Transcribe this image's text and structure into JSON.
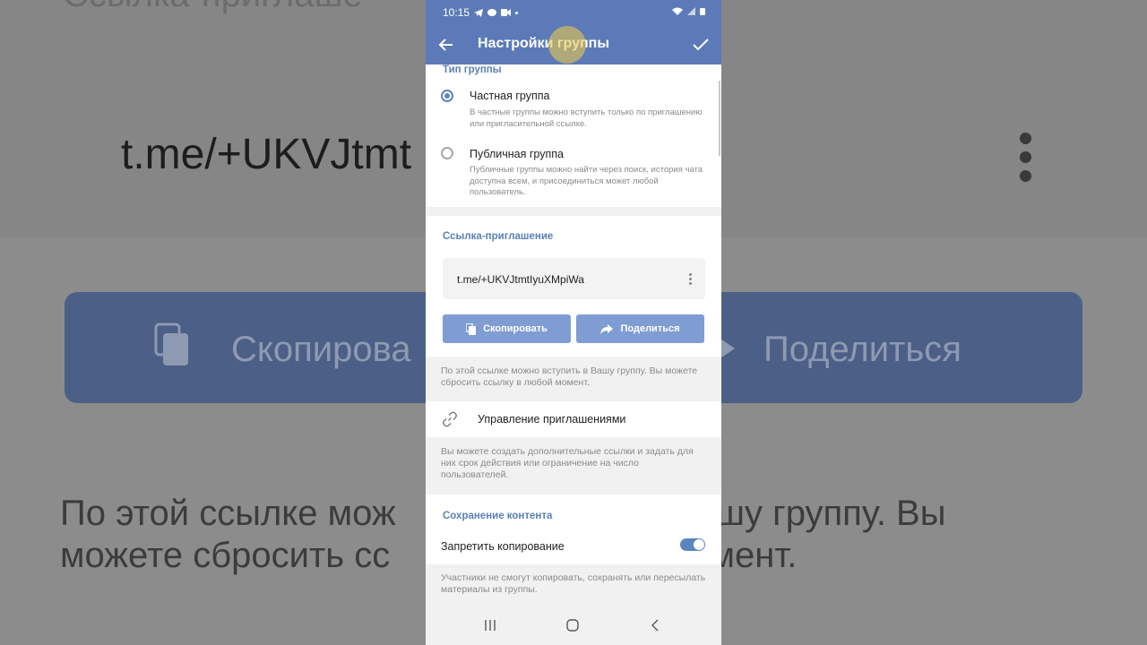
{
  "background": {
    "heading_fragment": "Ссылка-приглаше",
    "link_fragment": "t.me/+UKVJtmt",
    "copy_label_fragment": "Скопирова",
    "share_label": "Поделиться",
    "para_line1_left": "По этой ссылке мож",
    "para_line1_right": "ашу группу. Вы",
    "para_line2_left": "можете сбросить сс",
    "para_line2_right": "омент."
  },
  "status_bar": {
    "time": "10:15"
  },
  "header": {
    "title": "Настройки группы"
  },
  "group_type": {
    "section_title": "Тип группы",
    "options": [
      {
        "title": "Частная группа",
        "description": "В частные группы можно вступить только по приглашению или пригласительной ссылке.",
        "selected": true
      },
      {
        "title": "Публичная группа",
        "description": "Публичные группы можно найти через поиск, история чата доступна всем, и присоединиться может любой пользователь.",
        "selected": false
      }
    ]
  },
  "invite": {
    "section_title": "Ссылка-приглашение",
    "link": "t.me/+UKVJtmtIyuXMpiWa",
    "copy_label": "Скопировать",
    "share_label": "Поделиться",
    "hint": "По этой ссылке можно вступить в Вашу группу. Вы можете сбросить ссылку в любой момент."
  },
  "manage": {
    "label": "Управление приглашениями",
    "hint": "Вы можете создать дополнительные ссылки и задать для них срок действия или ограничение на число пользователей."
  },
  "content": {
    "section_title": "Сохранение контента",
    "restrict_label": "Запретить копирование",
    "restrict_enabled": true,
    "hint": "Участники не смогут копировать, сохранять или пересылать материалы из группы."
  },
  "colors": {
    "accent": "#5b7ab7",
    "button": "#7f9dd3",
    "section_title": "#5b80b5"
  }
}
